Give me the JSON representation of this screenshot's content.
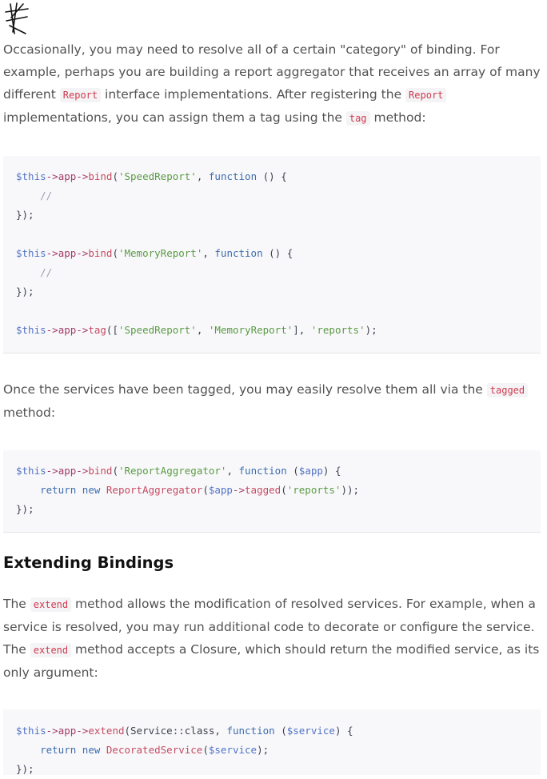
{
  "logo": {
    "icon": "scribble-logo-icon"
  },
  "paragraphs": {
    "p1": {
      "t1": "Occasionally, you may need to resolve all of a certain \"category\" of binding. For example, perhaps you are building a report aggregator that receives an array of many different ",
      "c1": "Report",
      "t2": " interface implementations. After registering the ",
      "c2": "Report",
      "t3": " implementations, you can assign them a tag using the ",
      "c3": "tag",
      "t4": " method:"
    },
    "p2": {
      "t1": "Once the services have been tagged, you may easily resolve them all via the ",
      "c1": "tagged",
      "t2": " method:"
    },
    "p3": {
      "t1": "The ",
      "c1": "extend",
      "t2": " method allows the modification of resolved services. For example, when a service is resolved, you may run additional code to decorate or configure the service. The ",
      "c2": "extend",
      "t3": " method accepts a Closure, which should return the modified service, as its only argument:"
    }
  },
  "heading": "Extending Bindings",
  "code": {
    "this": "$this",
    "arrow": "->",
    "app": "app",
    "bind": "bind",
    "tag": "tag",
    "extend": "extend",
    "tagged": "tagged",
    "function": "function",
    "return": "return",
    "new": "new",
    "comment": "//",
    "speed": "'SpeedReport'",
    "memory": "'MemoryReport'",
    "reports": "'reports'",
    "aggregatorStr": "'ReportAggregator'",
    "aggregatorClass": "ReportAggregator",
    "decorated": "DecoratedService",
    "service_class": "Service::class",
    "appVar": "$app",
    "serviceVar": "$service",
    "lparen": "(",
    "rparen": ")",
    "lbracket": "[",
    "rbracket": "]",
    "comma": ", ",
    "empty_args": " () {",
    "brace_open": " {",
    "close": "});",
    "end_stmt": ");",
    "nested_end": "));",
    "indent": "    "
  },
  "colors": {
    "variable": "#5273c7",
    "arrow": "#a23b68",
    "function_call": "#c54b62",
    "string": "#5a9b44",
    "keyword": "#3c6cae",
    "comment": "#9aa0ad",
    "inline_code": "#d0394e"
  }
}
